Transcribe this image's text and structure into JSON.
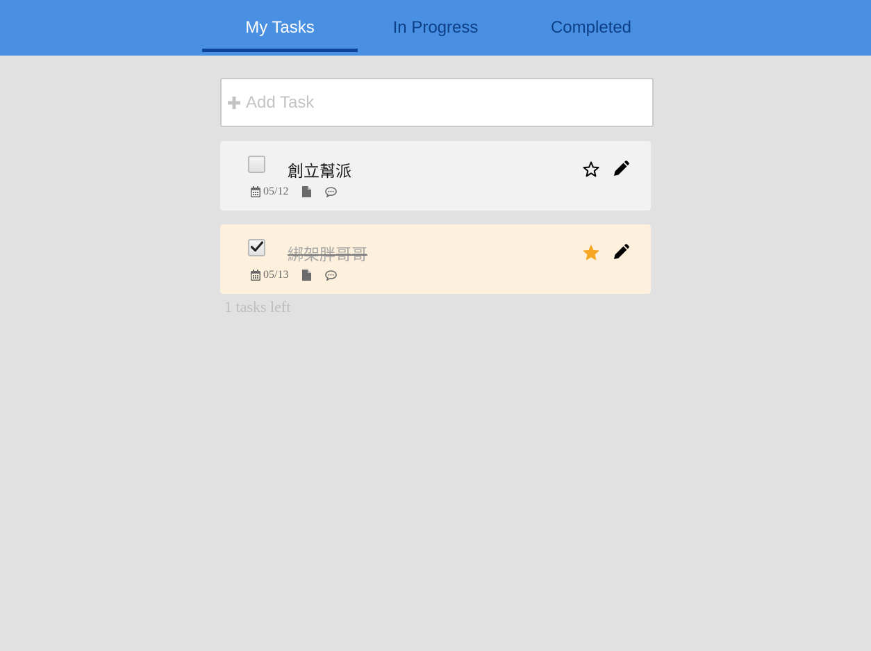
{
  "tabs": [
    {
      "label": "My Tasks",
      "active": true
    },
    {
      "label": "In Progress",
      "active": false
    },
    {
      "label": "Completed",
      "active": false
    }
  ],
  "add_task": {
    "label": "Add Task",
    "icon": "plus-icon"
  },
  "tasks": [
    {
      "title": "創立幫派",
      "date": "05/12",
      "checked": false,
      "starred": false,
      "icons": [
        "calendar-icon",
        "file-icon",
        "comment-icon",
        "star-icon",
        "pencil-icon"
      ]
    },
    {
      "title": "綁架胖哥哥",
      "date": "05/13",
      "checked": true,
      "starred": true,
      "icons": [
        "calendar-icon",
        "file-icon",
        "comment-icon",
        "star-icon",
        "pencil-icon"
      ]
    }
  ],
  "footer": {
    "tasks_left": "1 tasks left"
  },
  "colors": {
    "header": "#4a90e2",
    "tab_active_text": "#ffffff",
    "tab_inactive_text": "#0d3f87",
    "tab_underline": "#0c449a",
    "background": "#e1e1e1",
    "task_default_bg": "#f2f2f2",
    "task_important_bg": "#fdf0dc",
    "star_filled": "#f5a623"
  }
}
